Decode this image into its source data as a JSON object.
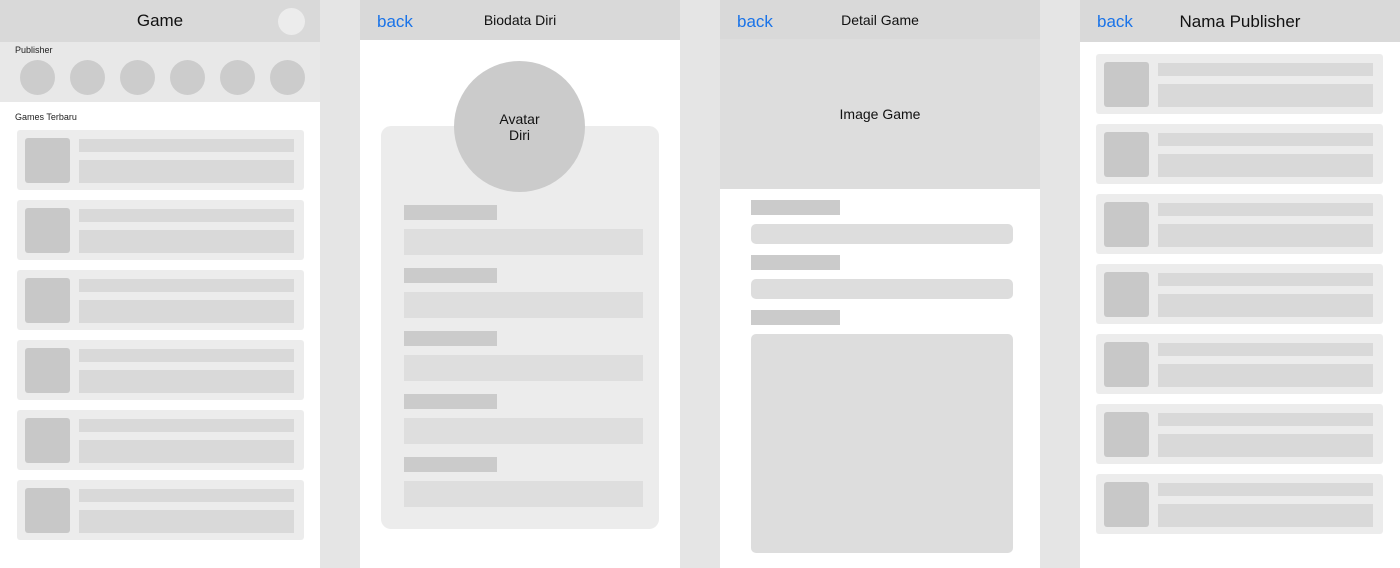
{
  "screens": {
    "home": {
      "title": "Game",
      "publisher_label": "Publisher",
      "games_label": "Games Terbaru"
    },
    "biodata": {
      "back_label": "back",
      "title": "Biodata Diri",
      "avatar_label": "Avatar Diri"
    },
    "detail": {
      "back_label": "back",
      "title": "Detail Game",
      "image_label": "Image Game"
    },
    "publisher": {
      "back_label": "back",
      "title": "Nama Publisher"
    }
  },
  "colors": {
    "background": "#e5e5e5",
    "topbar": "#d9d9d9",
    "link": "#1a73e8",
    "placeholder_dark": "#c8c8c8",
    "placeholder_light": "#d9d9d9",
    "card": "#ececec"
  }
}
